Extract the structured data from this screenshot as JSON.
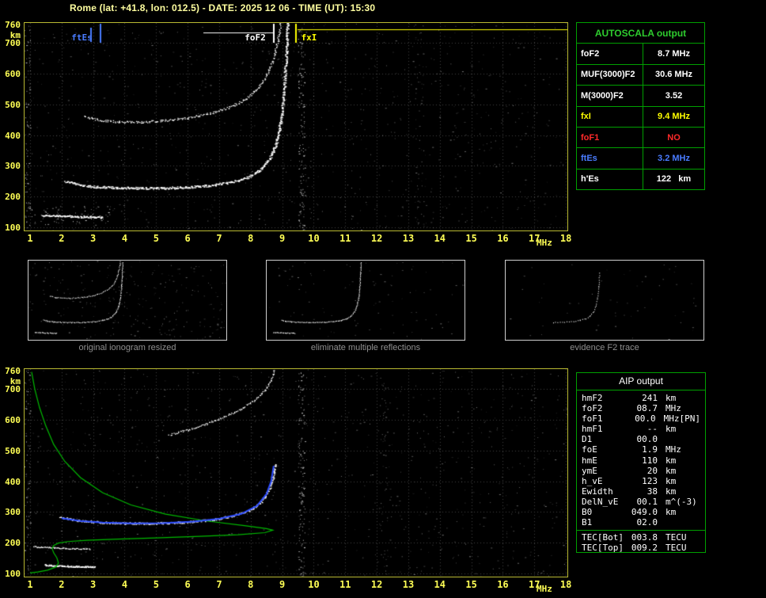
{
  "header": {
    "title": "Rome (lat: +41.8, lon: 012.5) - DATE: 2025 12 06 - TIME (UT): 15:30"
  },
  "axis": {
    "y_unit": "km",
    "y_ticks": [
      760,
      700,
      600,
      500,
      400,
      300,
      200,
      100
    ],
    "x_ticks": [
      1,
      2,
      3,
      4,
      5,
      6,
      7,
      8,
      9,
      10,
      11,
      12,
      13,
      14,
      15,
      16,
      17,
      18
    ],
    "x_unit": "MHz"
  },
  "top_plot": {
    "markers": [
      {
        "label": "ftEs",
        "mhz": 3.2,
        "color": "#4a7cff",
        "side": "left",
        "leader": "none"
      },
      {
        "label": "foF2",
        "mhz": 8.7,
        "color": "#ffffff",
        "side": "left",
        "leader": "left"
      },
      {
        "label": "fxI",
        "mhz": 9.4,
        "color": "#ffff00",
        "side": "right",
        "leader": "right"
      }
    ]
  },
  "autoscala": {
    "title": "AUTOSCALA output",
    "rows": [
      {
        "label": "foF2",
        "value": "8.7 MHz",
        "color": "#ffffff"
      },
      {
        "label": "MUF(3000)F2",
        "value": "30.6 MHz",
        "color": "#ffffff"
      },
      {
        "label": "M(3000)F2",
        "value": "3.52",
        "color": "#ffffff"
      },
      {
        "label": "fxI",
        "value": "9.4 MHz",
        "color": "#ffff00"
      },
      {
        "label": "foF1",
        "value": "NO",
        "color": "#ff2a2a"
      },
      {
        "label": "ftEs",
        "value": "3.2 MHz",
        "color": "#4a7cff"
      },
      {
        "label": "h'Es",
        "value": "122   km",
        "color": "#ffffff"
      }
    ]
  },
  "panels": [
    {
      "caption": "original ionogram resized"
    },
    {
      "caption": "eliminate multiple reflections"
    },
    {
      "caption": "evidence F2 trace"
    }
  ],
  "aip": {
    "title": "AIP output",
    "rows": [
      {
        "label": "hmF2",
        "value": "241",
        "unit": "km",
        "note": ""
      },
      {
        "label": "foF2",
        "value": "08.7",
        "unit": "MHz",
        "note": ""
      },
      {
        "label": "foF1",
        "value": "00.0",
        "unit": "MHz",
        "note": "[PN]"
      },
      {
        "label": "hmF1",
        "value": "--",
        "unit": "km",
        "note": ""
      },
      {
        "label": "D1",
        "value": "00.0",
        "unit": "",
        "note": ""
      },
      {
        "label": "foE",
        "value": "1.9",
        "unit": "MHz",
        "note": ""
      },
      {
        "label": "hmE",
        "value": "110",
        "unit": "km",
        "note": ""
      },
      {
        "label": "ymE",
        "value": "20",
        "unit": "km",
        "note": ""
      },
      {
        "label": "h_vE",
        "value": "123",
        "unit": "km",
        "note": ""
      },
      {
        "label": "Ewidth",
        "value": "38",
        "unit": "km",
        "note": ""
      },
      {
        "label": "DelN_vE",
        "value": "00.1",
        "unit": "m^(-3)",
        "note": ""
      },
      {
        "label": "B0",
        "value": "049.0",
        "unit": "km",
        "note": ""
      },
      {
        "label": "B1",
        "value": "02.0",
        "unit": "",
        "note": ""
      }
    ],
    "tec_rows": [
      {
        "label": "TEC[Bot]",
        "value": "003.8",
        "unit": "TECU"
      },
      {
        "label": "TEC[Top]",
        "value": "009.2",
        "unit": "TECU"
      }
    ]
  },
  "traces": {
    "top_first_hop": [
      [
        2.1,
        250
      ],
      [
        2.5,
        240
      ],
      [
        3,
        233
      ],
      [
        4,
        229
      ],
      [
        5,
        228
      ],
      [
        6,
        231
      ],
      [
        6.8,
        238
      ],
      [
        7.4,
        248
      ],
      [
        7.9,
        263
      ],
      [
        8.3,
        288
      ],
      [
        8.6,
        325
      ],
      [
        8.8,
        375
      ],
      [
        8.95,
        445
      ],
      [
        9.05,
        545
      ],
      [
        9.12,
        670
      ],
      [
        9.16,
        770
      ]
    ],
    "top_second_hop": [
      [
        2.7,
        462
      ],
      [
        3.2,
        450
      ],
      [
        3.8,
        444
      ],
      [
        4.5,
        443
      ],
      [
        5.2,
        448
      ],
      [
        6,
        457
      ],
      [
        6.7,
        471
      ],
      [
        7.3,
        491
      ],
      [
        7.8,
        516
      ],
      [
        8.2,
        550
      ],
      [
        8.5,
        595
      ],
      [
        8.7,
        645
      ],
      [
        8.85,
        705
      ],
      [
        8.95,
        770
      ]
    ],
    "top_es": [
      [
        1.35,
        140
      ],
      [
        2.3,
        136
      ],
      [
        3.3,
        133
      ]
    ],
    "evidence_f2": [
      [
        5,
        228
      ],
      [
        6,
        231
      ],
      [
        6.8,
        238
      ],
      [
        7.4,
        248
      ],
      [
        7.9,
        263
      ],
      [
        8.3,
        288
      ],
      [
        8.6,
        325
      ],
      [
        8.8,
        375
      ],
      [
        8.95,
        445
      ],
      [
        9.05,
        545
      ],
      [
        9.12,
        670
      ]
    ],
    "bottom_first_hop": [
      [
        1.95,
        283
      ],
      [
        2.5,
        273
      ],
      [
        3.2,
        267
      ],
      [
        4,
        264
      ],
      [
        5,
        264
      ],
      [
        6,
        268
      ],
      [
        6.8,
        276
      ],
      [
        7.4,
        288
      ],
      [
        7.9,
        304
      ],
      [
        8.3,
        330
      ],
      [
        8.55,
        368
      ],
      [
        8.7,
        412
      ],
      [
        8.78,
        458
      ]
    ],
    "bottom_second_hop": [
      [
        5.4,
        552
      ],
      [
        6,
        568
      ],
      [
        6.6,
        588
      ],
      [
        7.2,
        612
      ],
      [
        7.7,
        637
      ],
      [
        8.1,
        663
      ],
      [
        8.45,
        697
      ],
      [
        8.65,
        732
      ],
      [
        8.75,
        765
      ]
    ],
    "bottom_blue": [
      [
        2,
        280
      ],
      [
        2.6,
        271
      ],
      [
        3.3,
        266
      ],
      [
        4.2,
        263
      ],
      [
        5.2,
        264
      ],
      [
        6.2,
        269
      ],
      [
        7,
        278
      ],
      [
        7.7,
        294
      ],
      [
        8.2,
        320
      ],
      [
        8.5,
        358
      ],
      [
        8.65,
        400
      ],
      [
        8.73,
        450
      ]
    ],
    "bottom_es_low": [
      [
        1.45,
        128
      ],
      [
        2.3,
        124
      ],
      [
        3.05,
        122
      ]
    ],
    "bottom_es_mid": [
      [
        1.1,
        188
      ],
      [
        2,
        183
      ],
      [
        2.9,
        180
      ]
    ],
    "profile_green": [
      [
        1.05,
        756
      ],
      [
        1.15,
        700
      ],
      [
        1.3,
        640
      ],
      [
        1.5,
        580
      ],
      [
        1.75,
        520
      ],
      [
        2.1,
        465
      ],
      [
        2.6,
        412
      ],
      [
        3.3,
        363
      ],
      [
        4.2,
        323
      ],
      [
        5.3,
        293
      ],
      [
        6.6,
        271
      ],
      [
        7.8,
        256
      ],
      [
        8.5,
        246
      ],
      [
        8.7,
        241
      ],
      [
        8.45,
        233
      ],
      [
        7.6,
        226
      ],
      [
        6.4,
        221
      ],
      [
        5,
        216
      ],
      [
        3.8,
        212
      ],
      [
        2.8,
        208
      ],
      [
        2.2,
        204
      ],
      [
        1.9,
        199
      ],
      [
        1.75,
        191
      ],
      [
        1.7,
        181
      ],
      [
        1.75,
        167
      ],
      [
        1.85,
        151
      ],
      [
        1.9,
        134
      ],
      [
        1.82,
        121
      ],
      [
        1.55,
        111
      ],
      [
        1.25,
        105
      ],
      [
        1,
        102
      ]
    ]
  },
  "colors": {
    "axis_text": "#ffff55",
    "plot_border": "#b9b932",
    "grid": "#404040",
    "table_border": "#00a000",
    "profile_green": "#00bb00",
    "restored_blue": "#2b4bff",
    "caption_gray": "#8f8f8f"
  }
}
